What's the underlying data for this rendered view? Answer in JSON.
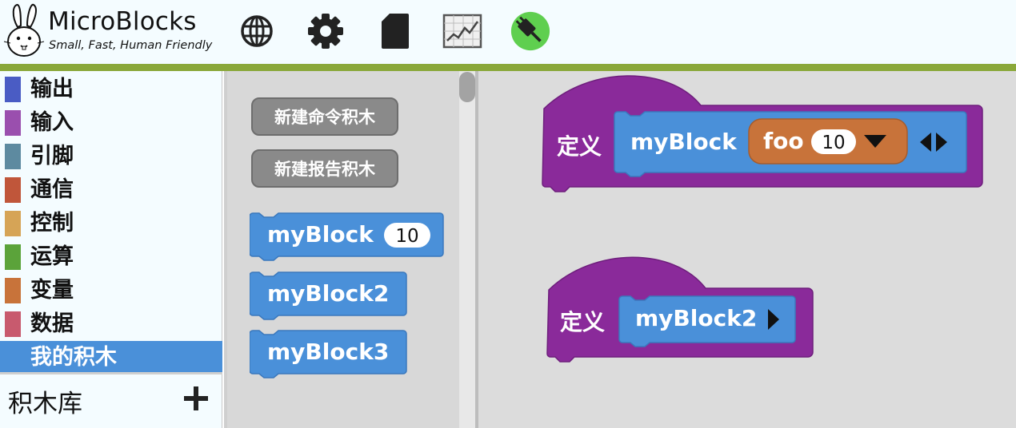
{
  "app": {
    "title": "MicroBlocks",
    "tagline": "Small, Fast, Human Friendly"
  },
  "toolbar": {
    "icons": [
      "globe-icon",
      "gear-icon",
      "file-icon",
      "graph-icon",
      "usb-connected-icon"
    ],
    "usb_status_color": "#5fcf4f"
  },
  "sidebar": {
    "categories": [
      {
        "label": "输出",
        "color": "#4a5cc4"
      },
      {
        "label": "输入",
        "color": "#9a4fae"
      },
      {
        "label": "引脚",
        "color": "#5d8aa0"
      },
      {
        "label": "通信",
        "color": "#c0563a"
      },
      {
        "label": "控制",
        "color": "#d6a456"
      },
      {
        "label": "运算",
        "color": "#5ba33a"
      },
      {
        "label": "变量",
        "color": "#c8733a"
      },
      {
        "label": "数据",
        "color": "#c85a6e"
      },
      {
        "label": "我的积木",
        "color": "#4a90d9"
      }
    ],
    "selected_index": 8,
    "library_label": "积木库",
    "library_add": "+"
  },
  "palette": {
    "buttons": [
      "新建命令积木",
      "新建报告积木"
    ],
    "blocks": [
      {
        "label": "myBlock",
        "arg": "10"
      },
      {
        "label": "myBlock2"
      },
      {
        "label": "myBlock3"
      }
    ]
  },
  "script": {
    "definitions": [
      {
        "keyword": "定义",
        "name": "myBlock",
        "param": "foo",
        "param_default": "10"
      },
      {
        "keyword": "定义",
        "name": "myBlock2"
      }
    ]
  },
  "colors": {
    "custom_block": "#4a90d9",
    "define_hat": "#8a2a9a",
    "param": "#c8733a"
  }
}
